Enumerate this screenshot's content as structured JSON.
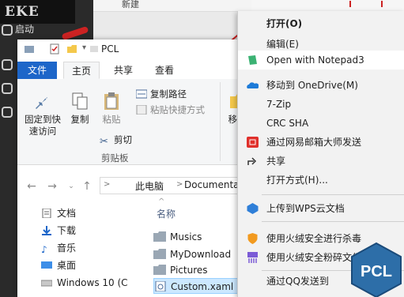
{
  "background": {
    "launcher_logo": "EKE",
    "launcher_item": "启动",
    "top_strip_text": "新建"
  },
  "explorer": {
    "title": "PCL",
    "tabs": [
      "文件",
      "主页",
      "共享",
      "查看"
    ],
    "ribbon": {
      "pin_label_1": "固定到快",
      "pin_label_2": "速访问",
      "copy_label": "复制",
      "paste_label": "粘贴",
      "copy_path": "复制路径",
      "paste_shortcut": "粘贴快捷方式",
      "cut": "剪切",
      "clipboard_group": "剪贴板",
      "move_partial": "移动"
    },
    "breadcrumb": [
      "此电脑",
      "Documentat"
    ],
    "nav_items": [
      "文档",
      "下载",
      "音乐",
      "桌面",
      "Windows 10 (C"
    ],
    "file_header": "名称",
    "files": [
      "Musics",
      "MyDownload",
      "Pictures",
      "Custom.xaml"
    ],
    "selected_file": "Custom.xaml"
  },
  "context_menu": {
    "items": [
      {
        "label": "打开(O)",
        "bold": true
      },
      {
        "label": "编辑(E)"
      },
      {
        "label": "Open with Notepad3",
        "highlighted": true
      },
      {
        "label": "移动到 OneDrive(M)"
      },
      {
        "label": "7-Zip"
      },
      {
        "label": "CRC SHA"
      },
      {
        "label": "通过网易邮箱大师发送"
      },
      {
        "label": "共享"
      },
      {
        "label": "打开方式(H)..."
      },
      {
        "label": "上传到WPS云文档"
      },
      {
        "label": "使用火绒安全进行杀毒"
      },
      {
        "label": "使用火绒安全粉碎文件"
      },
      {
        "label": "通过QQ发送到"
      }
    ]
  },
  "badge_text": "PCL",
  "colors": {
    "accent": "#1d66c9",
    "selected_bg": "#cce8ff",
    "menu_bg": "#f2f2f2",
    "badge_blue": "#2d6ea8"
  }
}
